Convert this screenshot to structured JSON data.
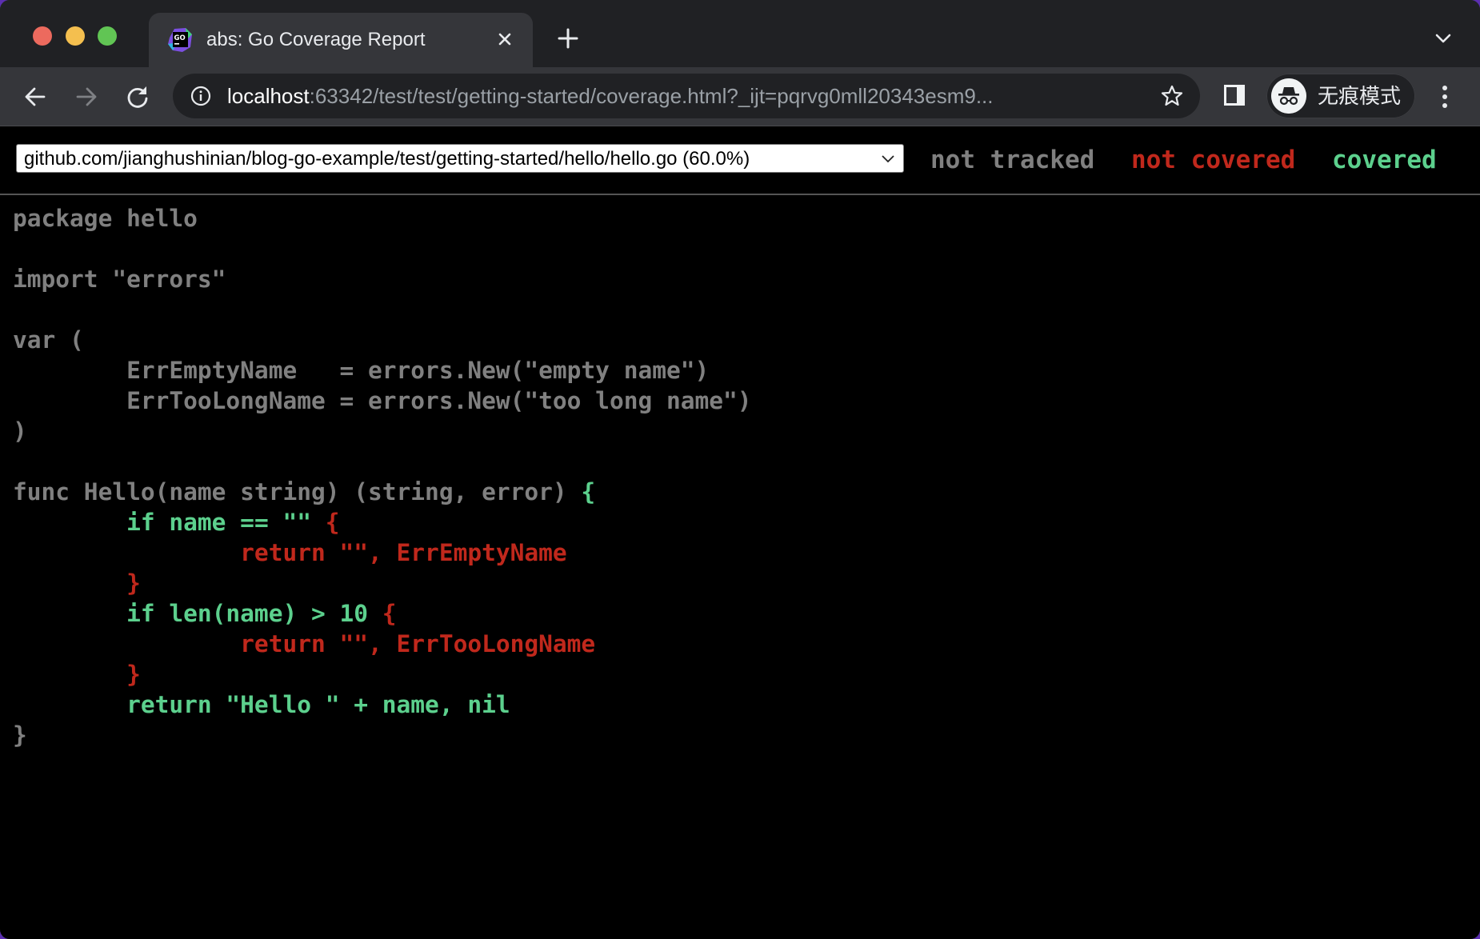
{
  "browser": {
    "tab": {
      "title": "abs: Go Coverage Report",
      "favicon": "goland-icon"
    },
    "new_tab_label": "+",
    "address": {
      "host": "localhost",
      "rest": ":63342/test/test/getting-started/coverage.html?_ijt=pqrvg0mll20343esm9..."
    },
    "incognito_label": "无痕模式"
  },
  "report": {
    "file_select": {
      "selected": "github.com/jianghushinian/blog-go-example/test/getting-started/hello/hello.go (60.0%)"
    },
    "legend": {
      "not_tracked": "not tracked",
      "not_covered": "not covered",
      "covered": "covered"
    },
    "colors": {
      "not_tracked": "#808080",
      "not_covered": "#c0281c",
      "covered": "#5cd08d"
    },
    "source_lines": [
      [
        {
          "t": "package hello",
          "c": "nottracked"
        }
      ],
      [
        {
          "t": "",
          "c": "nottracked"
        }
      ],
      [
        {
          "t": "import \"errors\"",
          "c": "nottracked"
        }
      ],
      [
        {
          "t": "",
          "c": "nottracked"
        }
      ],
      [
        {
          "t": "var (",
          "c": "nottracked"
        }
      ],
      [
        {
          "t": "        ErrEmptyName   = errors.New(\"empty name\")",
          "c": "nottracked"
        }
      ],
      [
        {
          "t": "        ErrTooLongName = errors.New(\"too long name\")",
          "c": "nottracked"
        }
      ],
      [
        {
          "t": ")",
          "c": "nottracked"
        }
      ],
      [
        {
          "t": "",
          "c": "nottracked"
        }
      ],
      [
        {
          "t": "func Hello(name string) (string, error) ",
          "c": "nottracked"
        },
        {
          "t": "{",
          "c": "cov8"
        }
      ],
      [
        {
          "t": "        ",
          "c": "cov8"
        },
        {
          "t": "if name == \"\"",
          "c": "cov8"
        },
        {
          "t": " {",
          "c": "cov0"
        }
      ],
      [
        {
          "t": "                return \"\", ErrEmptyName",
          "c": "cov0"
        }
      ],
      [
        {
          "t": "        }",
          "c": "cov0"
        }
      ],
      [
        {
          "t": "        if len(name) > 10",
          "c": "cov8"
        },
        {
          "t": " {",
          "c": "cov0"
        }
      ],
      [
        {
          "t": "                return \"\", ErrTooLongName",
          "c": "cov0"
        }
      ],
      [
        {
          "t": "        }",
          "c": "cov0"
        }
      ],
      [
        {
          "t": "        return \"Hello \" + name, nil",
          "c": "cov8"
        }
      ],
      [
        {
          "t": "}",
          "c": "nottracked"
        }
      ]
    ]
  }
}
